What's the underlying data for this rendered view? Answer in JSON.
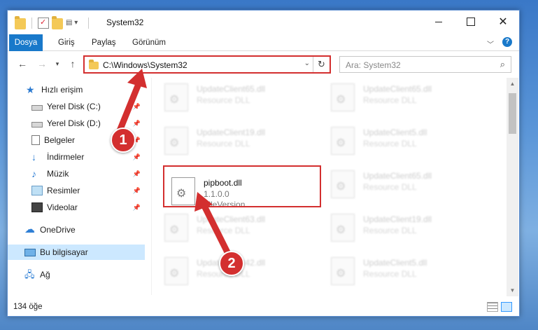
{
  "window": {
    "title": "System32",
    "controls": {
      "minimize": "",
      "maximize": "",
      "close": "✕"
    }
  },
  "ribbon": {
    "tabs": [
      "Dosya",
      "Giriş",
      "Paylaş",
      "Görünüm"
    ]
  },
  "address": {
    "path": "C:\\Windows\\System32",
    "search_placeholder": "Ara: System32"
  },
  "sidebar": {
    "items": [
      {
        "label": "Hızlı erişim",
        "icon": "star-icon"
      },
      {
        "label": "Yerel Disk (C:)",
        "icon": "drive-icon",
        "pinned": true
      },
      {
        "label": "Yerel Disk (D:)",
        "icon": "drive-icon",
        "pinned": true
      },
      {
        "label": "Belgeler",
        "icon": "documents-icon",
        "pinned": true
      },
      {
        "label": "İndirmeler",
        "icon": "download-icon",
        "pinned": true
      },
      {
        "label": "Müzik",
        "icon": "music-icon",
        "pinned": true
      },
      {
        "label": "Resimler",
        "icon": "pictures-icon",
        "pinned": true
      },
      {
        "label": "Videolar",
        "icon": "videos-icon",
        "pinned": true
      },
      {
        "label": "OneDrive",
        "icon": "onedrive-icon"
      },
      {
        "label": "Bu bilgisayar",
        "icon": "computer-icon",
        "selected": true
      },
      {
        "label": "Ağ",
        "icon": "network-icon"
      }
    ]
  },
  "files": [
    {
      "name": "UpdateClient65.dll",
      "sub": "Resource DLL"
    },
    {
      "name": "UpdateClient65.dll",
      "sub": "Resource DLL"
    },
    {
      "name": "UpdateClient19.dll",
      "sub": "Resource DLL"
    },
    {
      "name": "UpdateClient5.dll",
      "sub": "Resource DLL"
    },
    {
      "name": "pipboot.dll",
      "sub": "1.1.0.0",
      "sub2": "FileVersion",
      "focused": true
    },
    {
      "name": "UpdateClient65.dll",
      "sub": "Resource DLL"
    },
    {
      "name": "UpdateClient63.dll",
      "sub": "Resource DLL"
    },
    {
      "name": "UpdateClient19.dll",
      "sub": "Resource DLL"
    },
    {
      "name": "UpdateClient42.dll",
      "sub": "Resource DLL"
    },
    {
      "name": "UpdateClient5.dll",
      "sub": "Resource DLL"
    }
  ],
  "status": {
    "item_count": "134 öğe"
  },
  "annotations": {
    "marker1": "1",
    "marker2": "2",
    "color": "#d32f2f"
  },
  "colors": {
    "accent": "#1979ca",
    "selection": "#cce8ff"
  }
}
